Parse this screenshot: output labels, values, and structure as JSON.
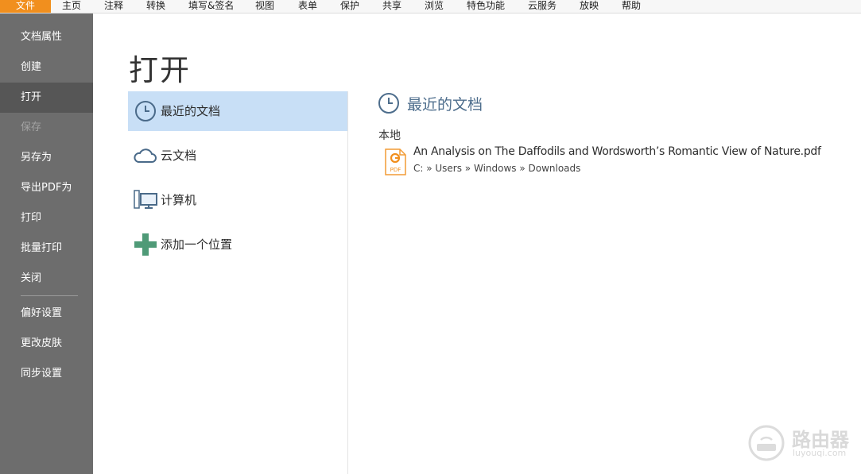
{
  "menu": {
    "items": [
      "文件",
      "主页",
      "注释",
      "转换",
      "填写&签名",
      "视图",
      "表单",
      "保护",
      "共享",
      "浏览",
      "特色功能",
      "云服务",
      "放映",
      "帮助"
    ],
    "active_index": 0
  },
  "sidebar": {
    "items": [
      {
        "label": "文档属性",
        "state": "normal"
      },
      {
        "label": "创建",
        "state": "normal"
      },
      {
        "label": "打开",
        "state": "selected"
      },
      {
        "label": "保存",
        "state": "disabled"
      },
      {
        "label": "另存为",
        "state": "normal"
      },
      {
        "label": "导出PDF为",
        "state": "normal"
      },
      {
        "label": "打印",
        "state": "normal"
      },
      {
        "label": "批量打印",
        "state": "normal"
      },
      {
        "label": "关闭",
        "state": "normal"
      },
      {
        "label": "偏好设置",
        "state": "normal"
      },
      {
        "label": "更改皮肤",
        "state": "normal"
      },
      {
        "label": "同步设置",
        "state": "normal"
      }
    ]
  },
  "page": {
    "title": "打开"
  },
  "locations": [
    {
      "label": "最近的文档",
      "icon": "clock-icon",
      "selected": true
    },
    {
      "label": "云文档",
      "icon": "cloud-icon",
      "selected": false
    },
    {
      "label": "计算机",
      "icon": "computer-icon",
      "selected": false
    },
    {
      "label": "添加一个位置",
      "icon": "plus-icon",
      "selected": false
    }
  ],
  "recent": {
    "title": "最近的文档",
    "group_label": "本地",
    "files": [
      {
        "name": "An Analysis on The Daffodils and Wordsworth’s Romantic View of Nature.pdf",
        "path": "C: » Users » Windows » Downloads",
        "icon_text": "PDF"
      }
    ]
  },
  "watermark": {
    "text": "路由器",
    "sub": "luyouqi.com"
  },
  "colors": {
    "accent": "#f18f1e",
    "sidebar": "#6d6d6d",
    "sidebar_selected": "#565656",
    "location_selected": "#c8dff6",
    "recent_title": "#4d6d8c"
  }
}
